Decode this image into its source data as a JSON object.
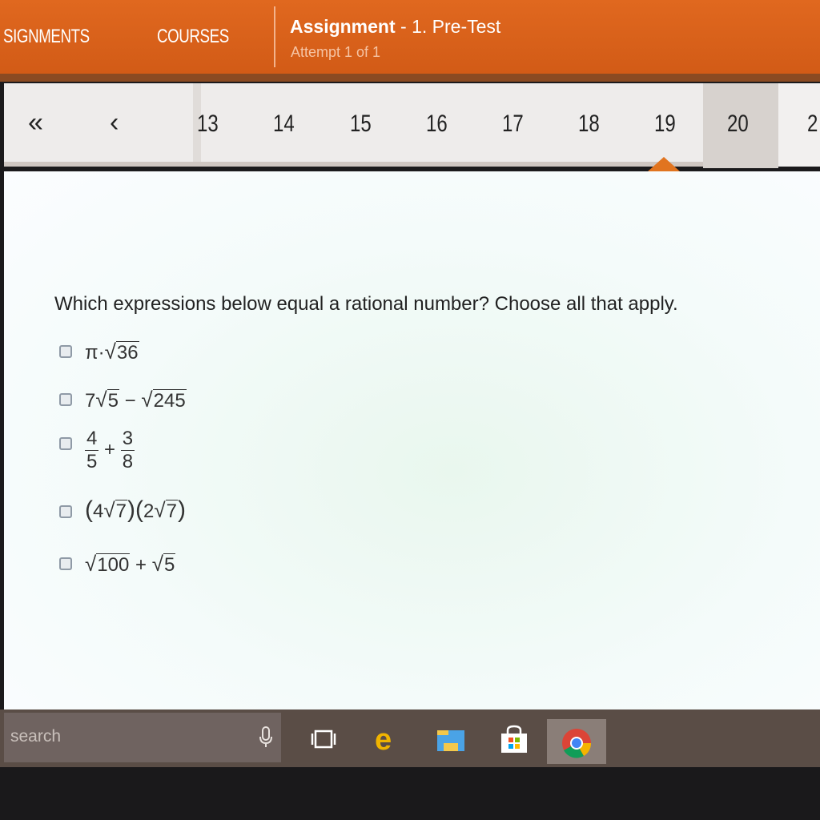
{
  "header": {
    "nav_assignments": "SIGNMENTS",
    "nav_courses": "COURSES",
    "assignment_label": "Assignment",
    "assignment_name": " - 1. Pre-Test",
    "attempt": "Attempt 1 of 1"
  },
  "pager": {
    "first_glyph": "«",
    "prev_glyph": "‹",
    "numbers": [
      "13",
      "14",
      "15",
      "16",
      "17",
      "18",
      "19"
    ],
    "current": "20",
    "next_partial": "2"
  },
  "question": {
    "prompt": "Which expressions below equal a rational number? Choose all that apply.",
    "options": [
      {
        "pi": "π",
        "dot": "·",
        "radical": "√",
        "radicand": "36"
      },
      {
        "coef": "7",
        "radical": "√",
        "radicand": "5",
        "minus": " − ",
        "radical2": "√",
        "radicand2": "245"
      },
      {
        "num1": "4",
        "den1": "5",
        "plus": "+",
        "num2": "3",
        "den2": "8"
      },
      {
        "lp1": "(",
        "coef1": "4",
        "radical": "√",
        "radicand1": "7",
        "rp1": ")",
        "lp2": "(",
        "coef2": "2",
        "radical2": "√",
        "radicand2": "7",
        "rp2": ")"
      },
      {
        "radical": "√",
        "radicand": "100",
        "plus": " + ",
        "radical2": "√",
        "radicand2": "5"
      }
    ]
  },
  "taskbar": {
    "search_placeholder": "search",
    "icons": [
      "microphone-icon",
      "task-view-icon",
      "edge-icon",
      "file-explorer-icon",
      "store-icon",
      "chrome-icon"
    ]
  },
  "colors": {
    "header_orange": "#e0681f",
    "marker_orange": "#e1741f",
    "taskbar": "#5a4d46"
  }
}
